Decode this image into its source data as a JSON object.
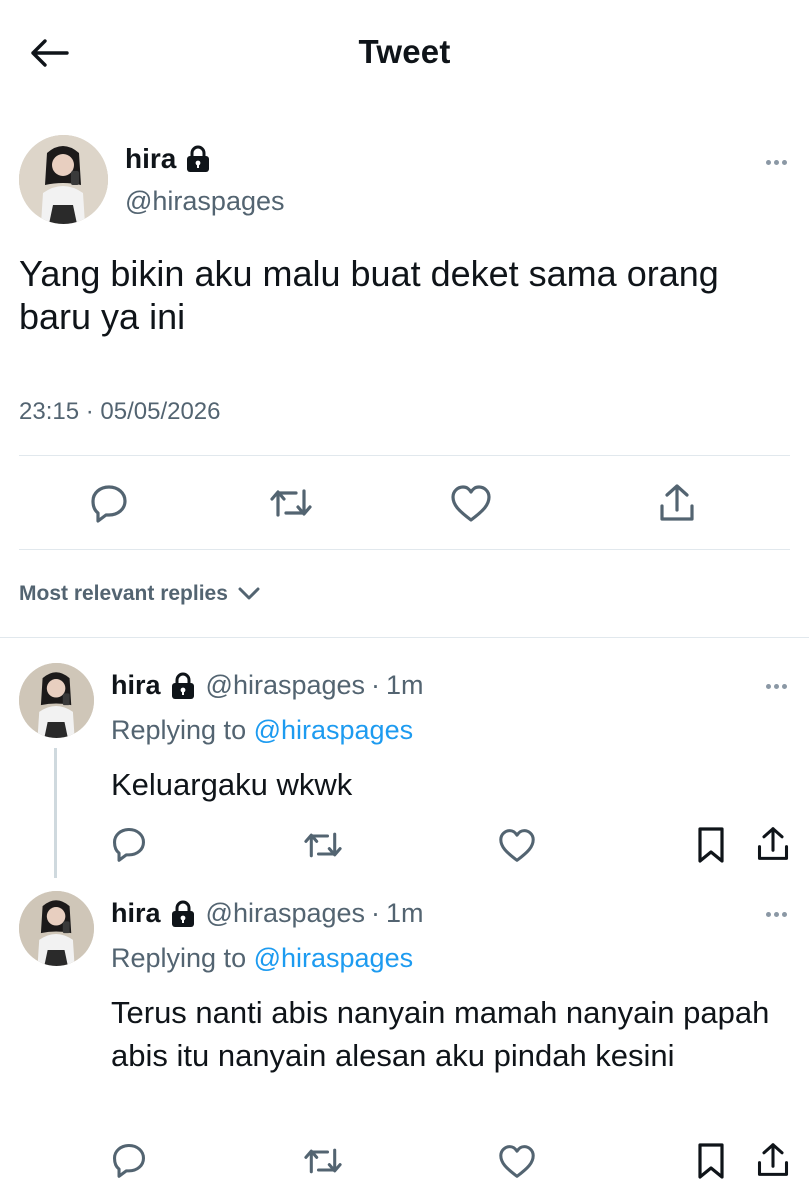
{
  "header": {
    "title": "Tweet"
  },
  "main_tweet": {
    "name": "hira",
    "handle": "@hiraspages",
    "text": "Yang bikin aku malu buat deket sama orang baru ya ini",
    "timestamp": "23:15 · 05/05/2026"
  },
  "sort": {
    "label": "Most relevant replies"
  },
  "replies": [
    {
      "name": "hira",
      "handle": "@hiraspages",
      "dot": "·",
      "time": "1m",
      "replying_prefix": "Replying to ",
      "replying_to": "@hiraspages",
      "text": "Keluargaku wkwk"
    },
    {
      "name": "hira",
      "handle": "@hiraspages",
      "dot": "·",
      "time": "1m",
      "replying_prefix": "Replying to ",
      "replying_to": "@hiraspages",
      "text": "Terus nanti abis nanyain mamah nanyain papah abis itu nanyain alesan aku pindah kesini"
    }
  ],
  "icons": {
    "back": "arrow-left-icon",
    "lock": "lock-icon",
    "more": "more-horizontal-icon",
    "reply": "reply-icon",
    "retweet": "retweet-icon",
    "like": "heart-icon",
    "share": "share-icon",
    "bookmark": "bookmark-icon",
    "chevron": "chevron-down-icon"
  },
  "colors": {
    "text": "#0f1419",
    "secondary": "#536471",
    "link": "#1d9bf0",
    "divider": "#e1e8ed"
  }
}
